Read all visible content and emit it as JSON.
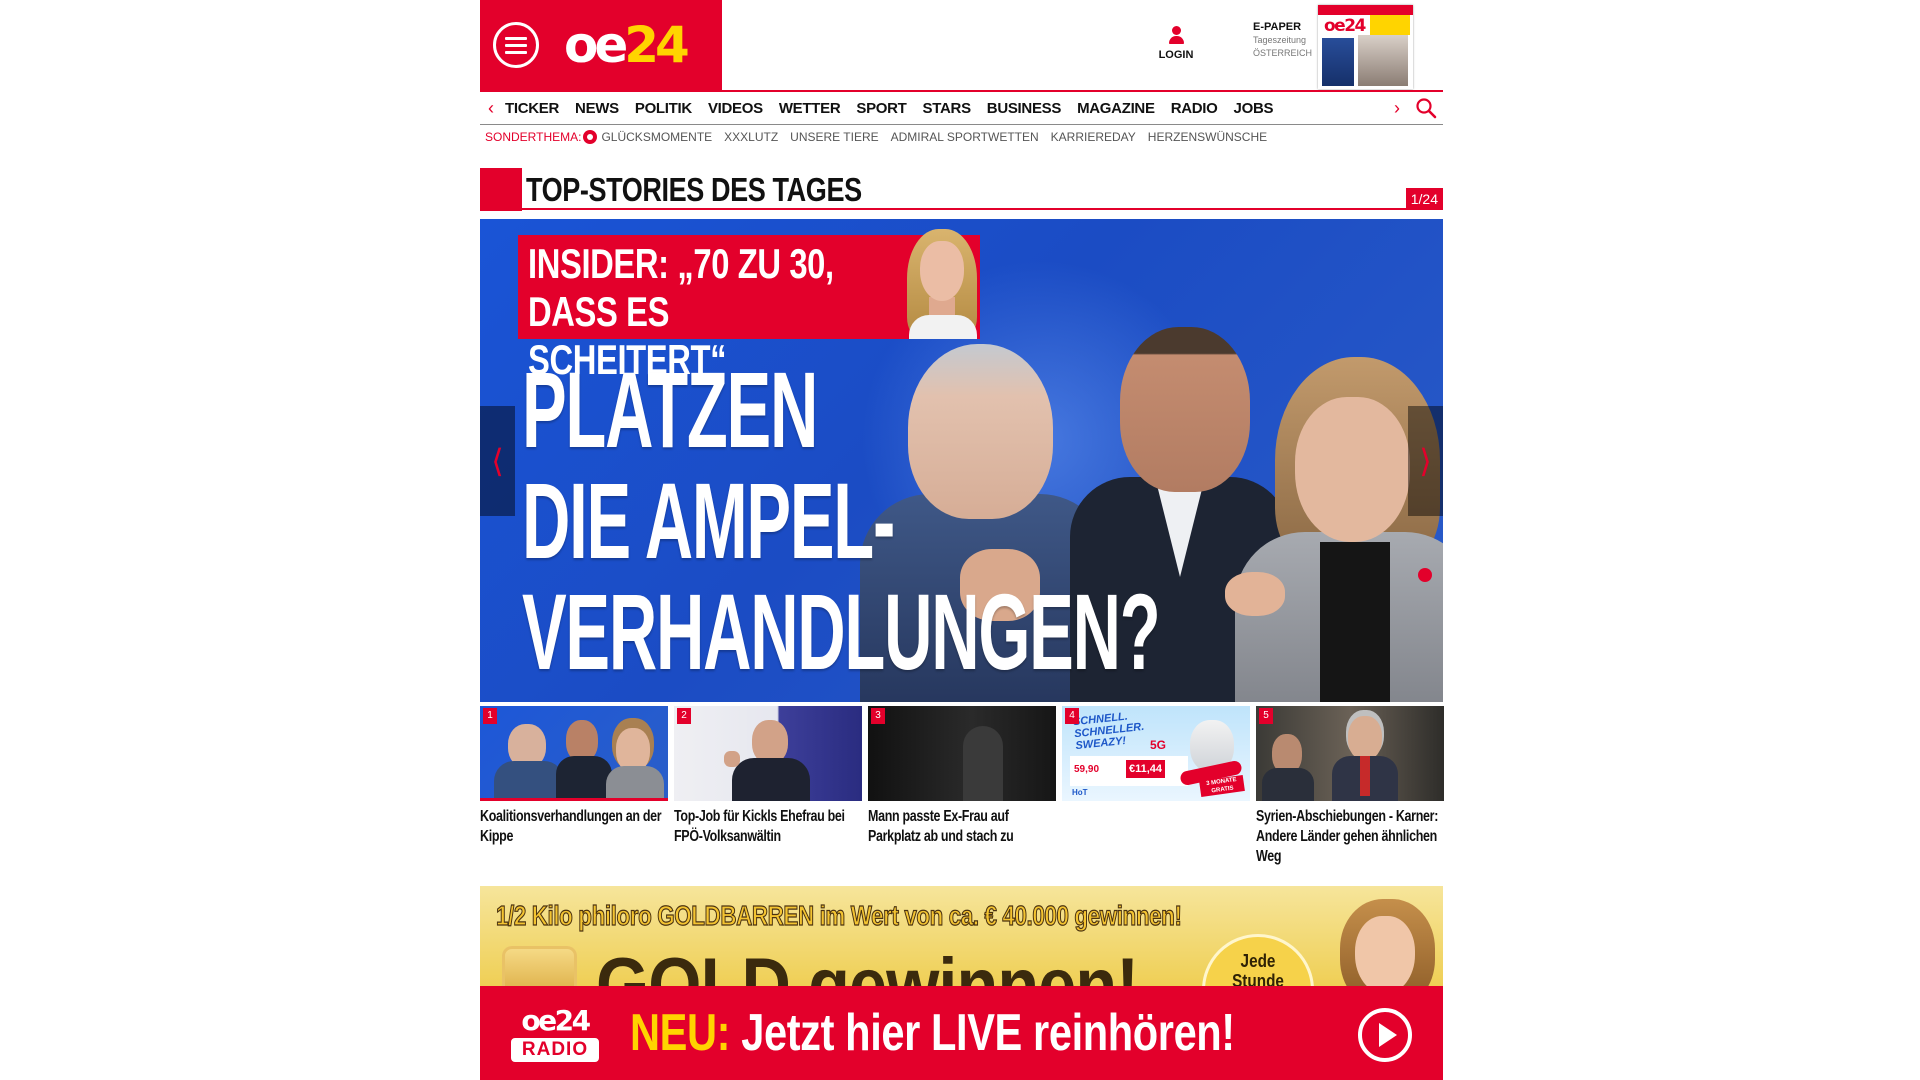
{
  "header": {
    "logo_oe": "oe",
    "logo_num": "24",
    "login_label": "LOGIN",
    "epaper": {
      "title": "E-PAPER",
      "subtitle": "Tageszeitung",
      "region": "ÖSTERREICH"
    }
  },
  "nav": {
    "items": [
      "TICKER",
      "NEWS",
      "POLITIK",
      "VIDEOS",
      "WETTER",
      "SPORT",
      "STARS",
      "BUSINESS",
      "MAGAZINE",
      "RADIO",
      "JOBS"
    ]
  },
  "special": {
    "label": "SONDERTHEMA:",
    "items": [
      "GLÜCKSMOMENTE",
      "XXXLUTZ",
      "UNSERE TIERE",
      "ADMIRAL SPORTWETTEN",
      "KARRIEREDAY",
      "HERZENSWÜNSCHE"
    ]
  },
  "top_stories": {
    "title": "TOP-STORIES DES TAGES",
    "counter": "1/24"
  },
  "hero": {
    "insider_line1": "INSIDER: „70 ZU 30,",
    "insider_line2": "DASS ES SCHEITERT“",
    "headline_line1": "PLATZEN",
    "headline_line2": "DIE AMPEL-",
    "headline_line3": "VERHANDLUNGEN?"
  },
  "thumbs": [
    {
      "num": "1",
      "title": "Koalitionsverhandlungen an der Kippe"
    },
    {
      "num": "2",
      "title": "Top-Job für Kickls Ehefrau bei FPÖ-Volksanwältin"
    },
    {
      "num": "3",
      "title": "Mann passte Ex-Frau auf Parkplatz ab und stach zu"
    },
    {
      "num": "4",
      "title": ""
    },
    {
      "num": "5",
      "title": "Syrien-Abschiebungen - Karner: Andere Länder gehen ähnlichen Weg"
    }
  ],
  "ad_thumb": {
    "headline": "SCHNELL. SCHNELLER. SWEAZY!",
    "tag": "5G",
    "price_left": "59,90",
    "price_right": "€11,44",
    "badge": "3 MONATE GRATIS",
    "brand": "HoT"
  },
  "ad_banner": {
    "line1": "1/2 Kilo philoro GOLDBARREN im Wert von ca. € 40.000 gewinnen!",
    "line2": "GOLD gewinnen!",
    "badge_line1": "Jede",
    "badge_line2": "Stunde"
  },
  "radio": {
    "logo_oe": "oe",
    "logo_num": "24",
    "logo_label": "RADIO",
    "neu": "NEU:",
    "text": "Jetzt hier LIVE reinhören!"
  },
  "colors": {
    "brand_red": "#e3002b",
    "brand_yellow": "#ffd400",
    "hero_blue": "#1a54d6"
  }
}
